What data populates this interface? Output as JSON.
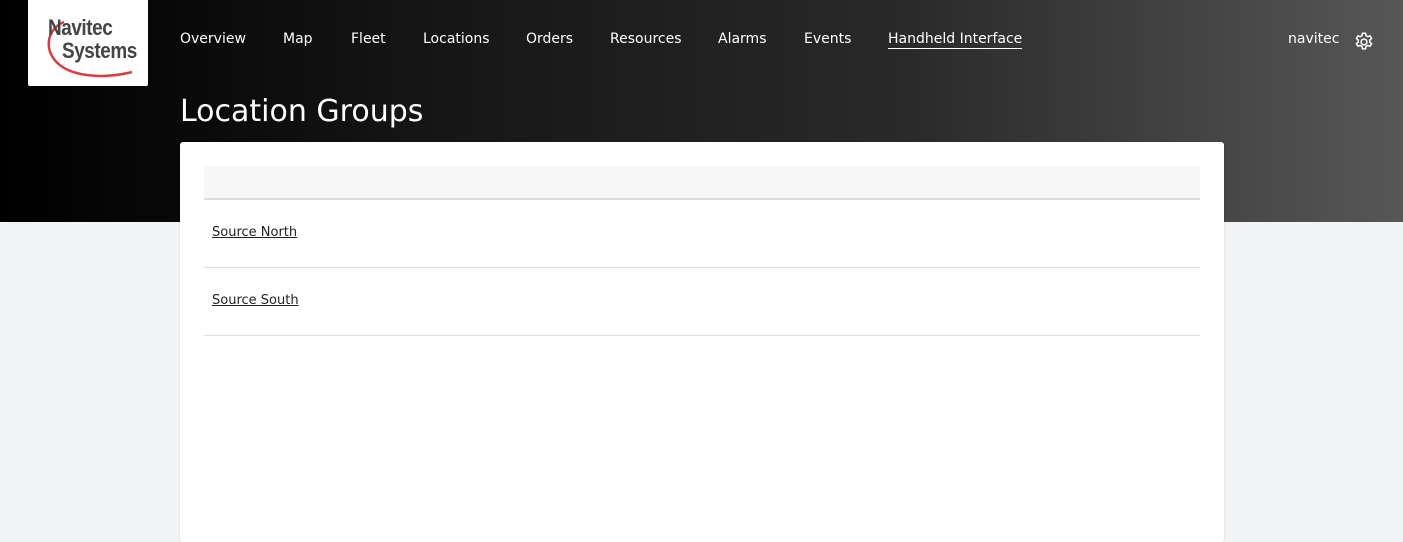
{
  "logo": {
    "line1": "Navitec",
    "line2": "Systems"
  },
  "nav": {
    "items": [
      {
        "label": "Overview"
      },
      {
        "label": "Map"
      },
      {
        "label": "Fleet"
      },
      {
        "label": "Locations"
      },
      {
        "label": "Orders"
      },
      {
        "label": "Resources"
      },
      {
        "label": "Alarms"
      },
      {
        "label": "Events"
      },
      {
        "label": "Handheld Interface",
        "active": true
      }
    ]
  },
  "user": {
    "name": "navitec",
    "settings_icon": "gear-icon"
  },
  "page": {
    "title": "Location Groups"
  },
  "groups": {
    "rows": [
      {
        "label": "Source North"
      },
      {
        "label": "Source South"
      }
    ]
  },
  "colors": {
    "header_start": "#000000",
    "header_end": "#575757",
    "page_background": "#f3f4f6",
    "logo_swoosh": "#e0393e"
  }
}
